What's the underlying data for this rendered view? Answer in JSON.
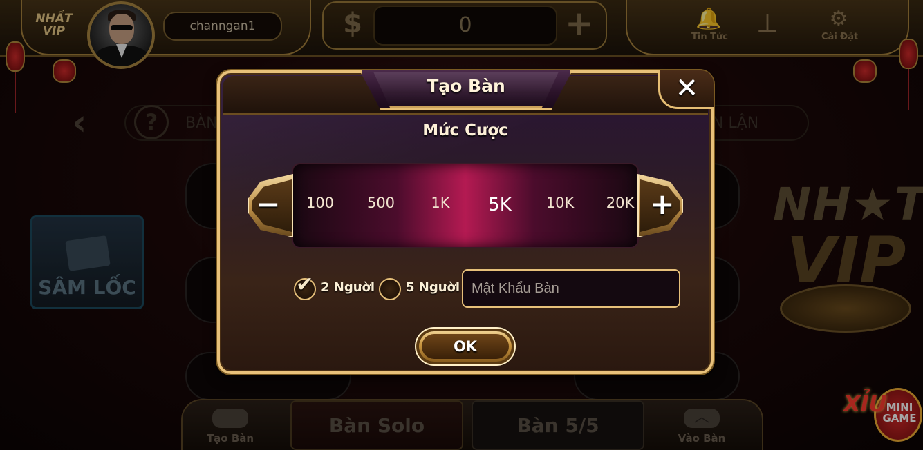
{
  "header": {
    "logo_text": "NHẤT VIP",
    "username": "channgan1",
    "balance": "0",
    "news_label": "Tin Tức",
    "settings_label": "Cài Đặt"
  },
  "background": {
    "nav_left_fragment": "BÀN",
    "nav_right_fragment": "N LẬN",
    "game_tile_title": "SÂM LỐC",
    "big_logo_line1": "NH★T",
    "big_logo_line2": "VIP"
  },
  "bottom_bar": {
    "create_table_label": "Tạo Bàn",
    "tab_solo": "Bàn Solo",
    "tab_five": "Bàn 5/5",
    "join_table_label": "Vào Bàn"
  },
  "mini_game": {
    "xiu": "XỈU",
    "mini": "MINI",
    "game": "GAME"
  },
  "dialog": {
    "title": "Tạo Bàn",
    "close_glyph": "✕",
    "bet_title": "Mức Cược",
    "minus_glyph": "−",
    "plus_glyph": "+",
    "bet_options": [
      "100",
      "500",
      "1K",
      "5K",
      "10K",
      "20K"
    ],
    "selected_bet": "5K",
    "player_options": [
      {
        "label": "2 Người",
        "checked": true
      },
      {
        "label": "5 Người",
        "checked": false
      }
    ],
    "check_glyph": "✔",
    "password_placeholder": "Mật Khẩu Bàn",
    "password_value": "",
    "ok_label": "OK"
  },
  "colors": {
    "gold_border": "#e6c07a",
    "bet_highlight": "#b41a52",
    "dialog_purple": "#2a1336"
  }
}
